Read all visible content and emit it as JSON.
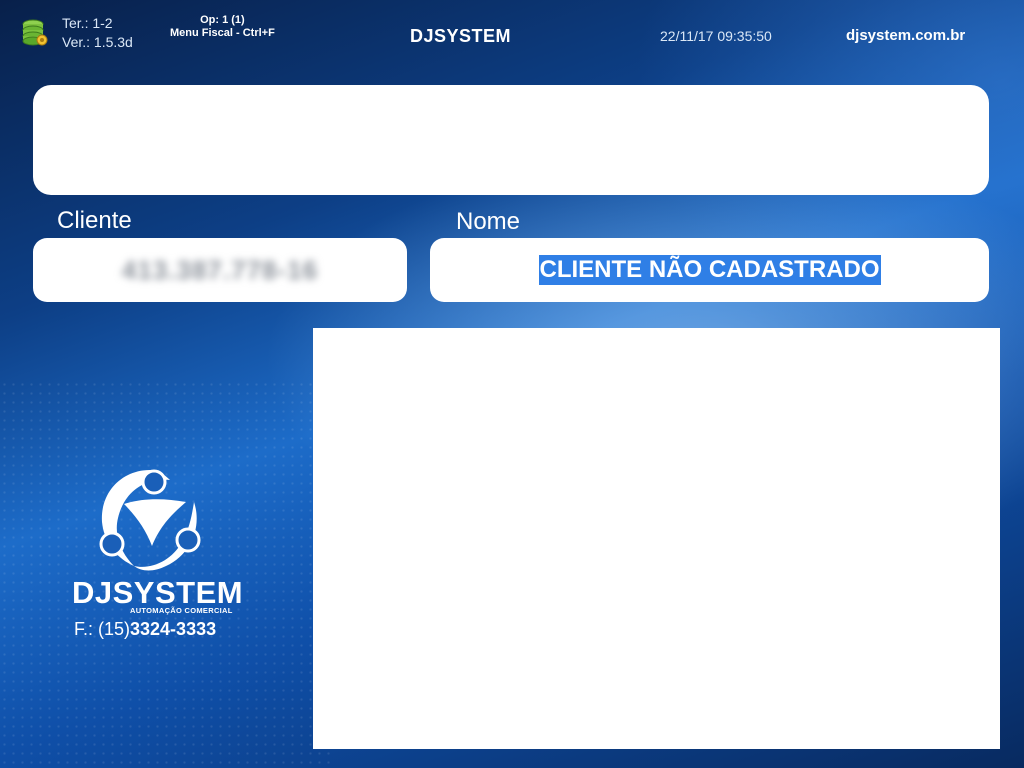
{
  "header": {
    "terminal": "Ter.: 1-2",
    "version": "Ver.: 1.5.3d",
    "operator": "Op: 1 (1)",
    "menu_hint": "Menu Fiscal - Ctrl+F",
    "title": "DJSYSTEM",
    "datetime": "22/11/17 09:35:50",
    "website": "djsystem.com.br"
  },
  "form": {
    "cliente_label": "Cliente",
    "cliente_value": "413.387.778-16",
    "nome_label": "Nome",
    "nome_value": "CLIENTE NÃO CADASTRADO"
  },
  "logo": {
    "brand": "DJSYSTEM",
    "tagline": "AUTOMAÇÃO COMERCIAL",
    "phone_prefix": "F.: (15)",
    "phone_number": "3324-3333"
  },
  "colors": {
    "selection": "#2f7fe6",
    "background_dark": "#0d3f86",
    "background_light": "#1d6cc9"
  },
  "icons": {
    "status": "database-icon"
  }
}
